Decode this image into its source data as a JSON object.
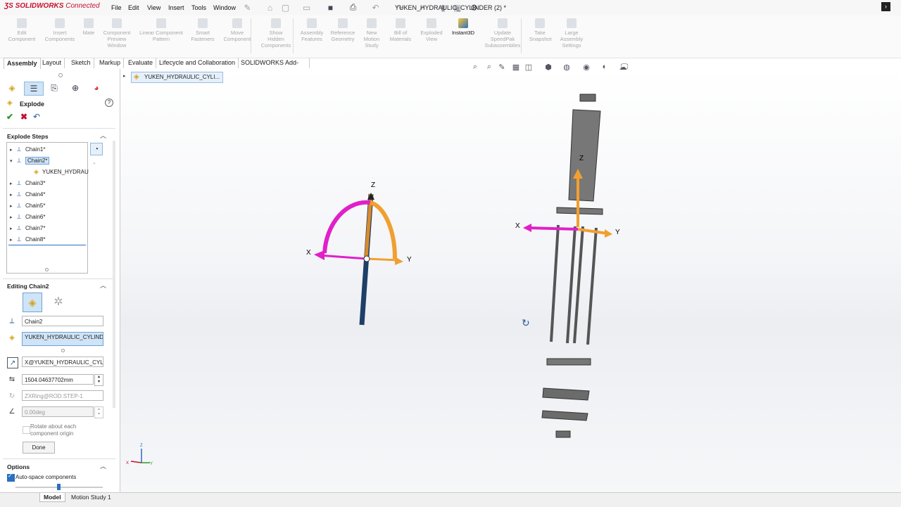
{
  "app": {
    "logo": "SOLIDWORKS",
    "logo_suffix": "Connected",
    "document_title": "YUKEN_HYDRAULIC_CYLINDER (2) *"
  },
  "menu": [
    "File",
    "Edit",
    "View",
    "Insert",
    "Tools",
    "Window"
  ],
  "command_manager": [
    {
      "label": "Edit\nComponent",
      "active": false
    },
    {
      "label": "Insert\nComponents",
      "active": false
    },
    {
      "label": "Mate",
      "active": false
    },
    {
      "label": "Component\nPreview\nWindow",
      "active": false
    },
    {
      "label": "Linear Component\nPattern",
      "active": false
    },
    {
      "label": "Smart\nFasteners",
      "active": false
    },
    {
      "label": "Move\nComponent",
      "active": false
    },
    {
      "label": "Show\nHidden\nComponents",
      "active": false
    },
    {
      "label": "Assembly\nFeatures",
      "active": false
    },
    {
      "label": "Reference\nGeometry",
      "active": false
    },
    {
      "label": "New\nMotion\nStudy",
      "active": false
    },
    {
      "label": "Bill of\nMaterials",
      "active": false
    },
    {
      "label": "Exploded\nView",
      "active": false
    },
    {
      "label": "Instant3D",
      "active": true
    },
    {
      "label": "Update\nSpeedPak\nSubassemblies",
      "active": false
    },
    {
      "label": "Take\nSnapshot",
      "active": false
    },
    {
      "label": "Large\nAssembly\nSettings",
      "active": false
    }
  ],
  "tabs": [
    "Assembly",
    "Layout",
    "Sketch",
    "Markup",
    "Evaluate",
    "Lifecycle and Collaboration",
    "SOLIDWORKS Add-Ins"
  ],
  "breadcrumb": "YUKEN_HYDRAULIC_CYLI...",
  "panel": {
    "title": "Explode",
    "help": "?",
    "explode_steps_header": "Explode Steps",
    "steps": [
      {
        "label": "Chain1*",
        "expanded": false,
        "selected": false
      },
      {
        "label": "Chain2*",
        "expanded": true,
        "selected": true
      },
      {
        "label": "YUKEN_HYDRAU",
        "child": true
      },
      {
        "label": "Chain3*",
        "expanded": false,
        "selected": false
      },
      {
        "label": "Chain4*",
        "expanded": false,
        "selected": false
      },
      {
        "label": "Chain5*",
        "expanded": false,
        "selected": false
      },
      {
        "label": "Chain6*",
        "expanded": false,
        "selected": false
      },
      {
        "label": "Chain7*",
        "expanded": false,
        "selected": false
      },
      {
        "label": "Chain8*",
        "expanded": false,
        "selected": false
      }
    ],
    "editing_header": "Editing Chain2",
    "step_name": "Chain2",
    "component": "YUKEN_HYDRAULIC_CYLINDER",
    "direction": "X@YUKEN_HYDRAULIC_CYLINE",
    "distance": "1504.04637702mm",
    "rotation_axis": "ZXRing@ROD.STEP-1",
    "angle": "0.00deg",
    "rotate_about_origin": "Rotate about each\ncomponent origin",
    "done": "Done",
    "options_header": "Options",
    "auto_space": "Auto-space components"
  },
  "triad": {
    "x": "X",
    "y": "Y",
    "z": "Z"
  },
  "mini_triad": {
    "x": "X",
    "y": "Y",
    "z": "Z"
  },
  "bottom_tabs": [
    "Model",
    "Motion Study 1"
  ],
  "colors": {
    "accent": "#2a6fc0",
    "brand": "#c8102e",
    "triad_x": "#e020c8",
    "triad_y": "#f0a030",
    "triad_z": "#f0a030"
  }
}
